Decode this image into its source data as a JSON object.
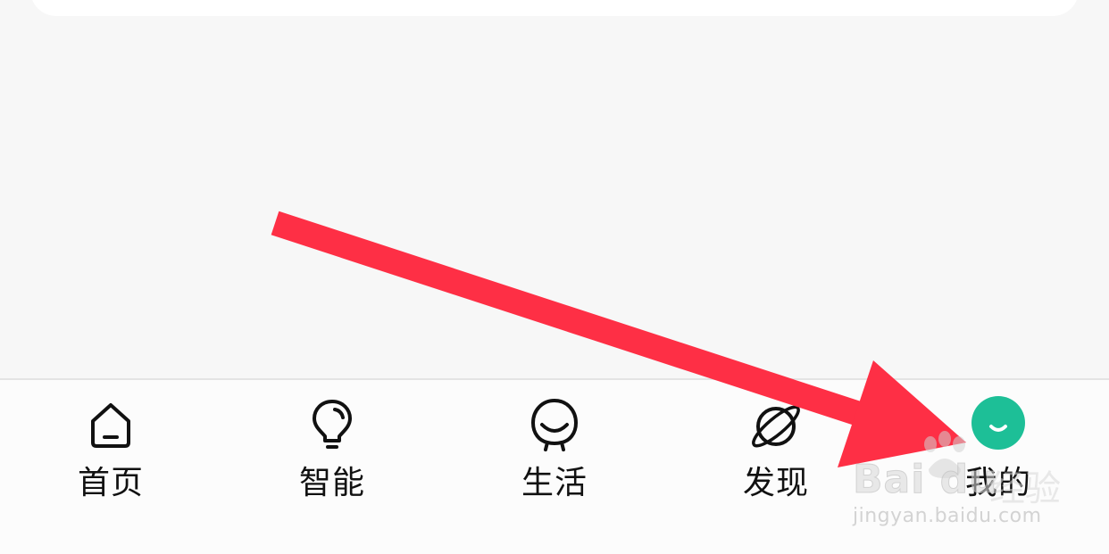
{
  "tab_bar": {
    "tabs": [
      {
        "id": "home",
        "label": "首页",
        "icon": "home-icon",
        "active": false
      },
      {
        "id": "smart",
        "label": "智能",
        "icon": "lightbulb-icon",
        "active": false
      },
      {
        "id": "life",
        "label": "生活",
        "icon": "smiley-face-icon",
        "active": false
      },
      {
        "id": "discover",
        "label": "发现",
        "icon": "planet-icon",
        "active": false
      },
      {
        "id": "mine",
        "label": "我的",
        "icon": "profile-avatar-icon",
        "active": true
      }
    ]
  },
  "colors": {
    "background": "#f7f7f7",
    "tab_bar": "#fcfcfc",
    "active_accent": "#1dbf97",
    "annotation_arrow": "#fe2f45",
    "label": "#111111"
  },
  "annotation": {
    "type": "arrow",
    "points_to": "mine"
  },
  "watermark": {
    "brand": "Bai du",
    "suffix": "经验",
    "url": "jingyan.baidu.com"
  }
}
